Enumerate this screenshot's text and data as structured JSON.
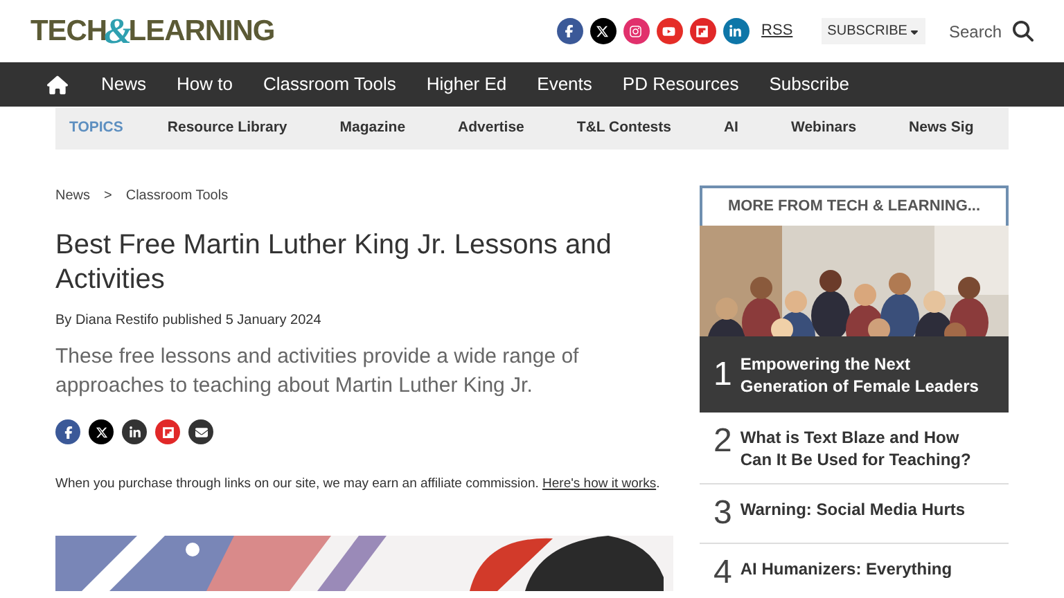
{
  "header": {
    "logo": {
      "left": "TECH",
      "amp": "&",
      "right": "LEARNING"
    },
    "social": [
      {
        "kind": "facebook",
        "color": "#3b5998"
      },
      {
        "kind": "x",
        "color": "#000000"
      },
      {
        "kind": "instagram",
        "color": "#e1306c"
      },
      {
        "kind": "youtube",
        "color": "#e52d27"
      },
      {
        "kind": "flipboard",
        "color": "#e12828"
      },
      {
        "kind": "linkedin",
        "color": "#0e76a8"
      }
    ],
    "rss": "RSS",
    "subscribe": "SUBSCRIBE",
    "search": "Search"
  },
  "nav": {
    "items": [
      "News",
      "How to",
      "Classroom Tools",
      "Higher Ed",
      "Events",
      "PD Resources",
      "Subscribe"
    ]
  },
  "topics": {
    "label": "TOPICS",
    "items": [
      "Resource Library",
      "Magazine",
      "Advertise",
      "T&L Contests",
      "AI",
      "Webinars",
      "News Sig"
    ]
  },
  "article": {
    "breadcrumbs": [
      "News",
      "Classroom Tools"
    ],
    "separator": ">",
    "title": "Best Free Martin Luther King Jr. Lessons and Activities",
    "byline": "By Diana Restifo published 5 January 2024",
    "standfirst": "These free lessons and activities provide a wide range of approaches to teaching about Martin Luther King Jr.",
    "share": [
      {
        "kind": "facebook",
        "color": "#3b5998"
      },
      {
        "kind": "x",
        "color": "#000000"
      },
      {
        "kind": "linkedin",
        "color": "#333333"
      },
      {
        "kind": "flipboard",
        "color": "#e12828"
      },
      {
        "kind": "email",
        "color": "#333333"
      }
    ],
    "disclaimer": "When you purchase through links on our site, we may earn an affiliate commission.",
    "disclaimer_link": "Here's how it works",
    "disclaimer_end": "."
  },
  "sidebar": {
    "heading": "MORE FROM TECH & LEARNING...",
    "items": [
      {
        "number": "1",
        "title": "Empowering the Next Generation of Female Leaders",
        "featured": true
      },
      {
        "number": "2",
        "title": "What is Text Blaze and How Can It Be Used for Teaching?",
        "featured": false
      },
      {
        "number": "3",
        "title": "Warning: Social Media Hurts",
        "featured": false
      },
      {
        "number": "4",
        "title": "AI Humanizers: Everything",
        "featured": false
      }
    ]
  }
}
